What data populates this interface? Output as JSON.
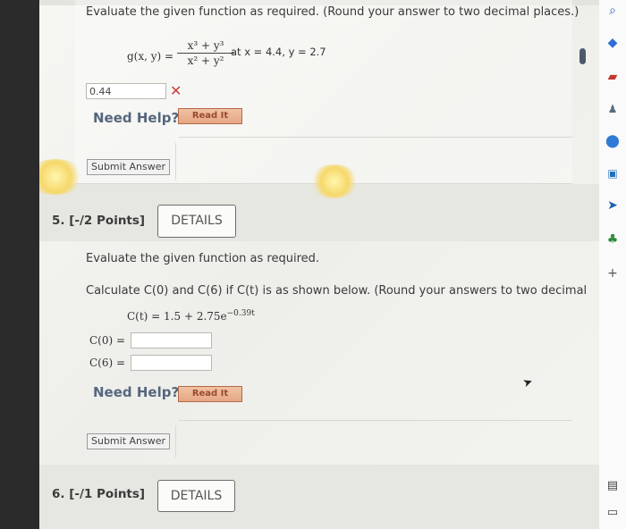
{
  "q4": {
    "instruction": "Evaluate the given function as required. (Round your answer to two decimal places.)",
    "fn_lhs": "g(x, y) =",
    "fn_num": "x³ + y³",
    "fn_den": "x² + y²",
    "fn_at": "at x = 4.4, y = 2.7",
    "answer_value": "0.44",
    "wrong_mark": "✕",
    "need_help": "Need Help?",
    "read_it": "Read It",
    "submit": "Submit Answer"
  },
  "q5": {
    "number": "5.  [-/2 Points]",
    "details": "DETAILS",
    "instruction": "Evaluate the given function as required.",
    "prompt": "Calculate C(0) and C(6) if C(t) is as shown below. (Round your answers to two decimal",
    "fn": "C(t) = 1.5 + 2.75e",
    "fn_exp": "−0.39t",
    "c0_label": "C(0)  =",
    "c6_label": "C(6)  =",
    "c0_value": "",
    "c6_value": "",
    "need_help": "Need Help?",
    "read_it": "Read It",
    "submit": "Submit Answer"
  },
  "q6": {
    "number": "6.  [-/1 Points]",
    "details": "DETAILS"
  },
  "sidebar": {
    "icons": [
      "search-icon",
      "tag-icon",
      "shopping-bag-icon",
      "people-icon",
      "settings-circle-icon",
      "outlook-icon",
      "send-icon",
      "tree-icon",
      "plus-icon",
      "window-icon"
    ]
  },
  "colors": {
    "need_help": "#55667e",
    "read_it_bg": "#eab08f",
    "wrong": "#c8413a"
  }
}
